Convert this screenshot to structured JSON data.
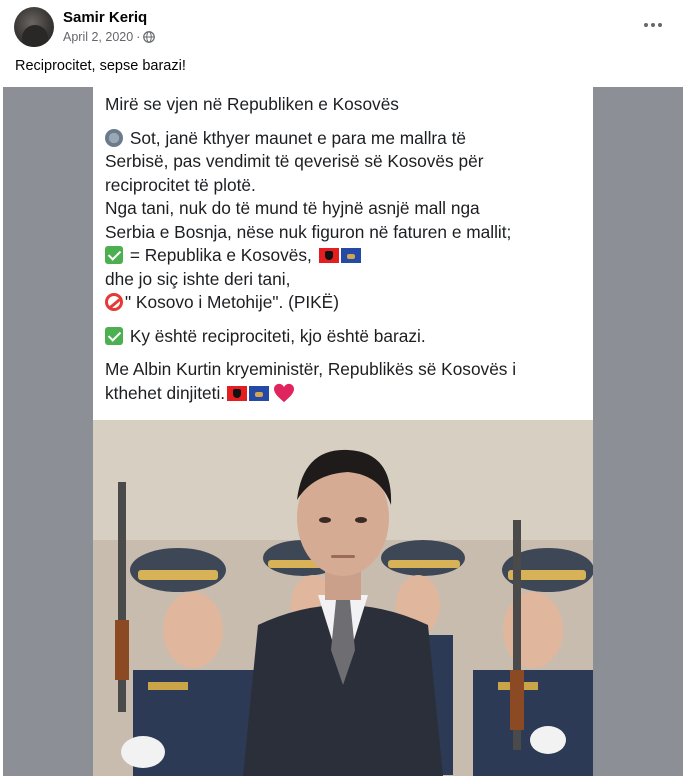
{
  "post": {
    "author": "Samir Keriq",
    "date": "April 2, 2020",
    "separator": "·",
    "audience_icon": "globe-icon",
    "menu_icon": "more-horizontal-icon",
    "caption": "Reciprocitet, sepse barazi!"
  },
  "image_text": {
    "line1": "Mirë se vjen në Republiken e Kosovës",
    "line2": "Sot, janë kthyer maunet e para me mallra të",
    "line3": "Serbisë, pas vendimit të qeverisë së Kosovës për",
    "line4": "reciprocitet të plotë.",
    "line5": "Nga tani, nuk do të mund të hyjnë asnjë mall nga",
    "line6": "Serbia e Bosnja, nëse nuk figuron në faturen e mallit;",
    "line7": "= Republika e Kosovës,",
    "line8": "dhe jo siç ishte deri tani,",
    "line9": "\" Kosovo i Metohije\". (PIKË)",
    "line10": "Ky është reciprociteti, kjo është barazi.",
    "line11": "Me Albin Kurtin kryeministër, Republikës së Kosovës i",
    "line12": "kthehet dinjiteti."
  },
  "colors": {
    "check": "#4caf50",
    "flag_albania": "#e41e20",
    "flag_kosovo": "#244aa5",
    "heart": "#e0245e",
    "media_background": "#8c9096"
  }
}
